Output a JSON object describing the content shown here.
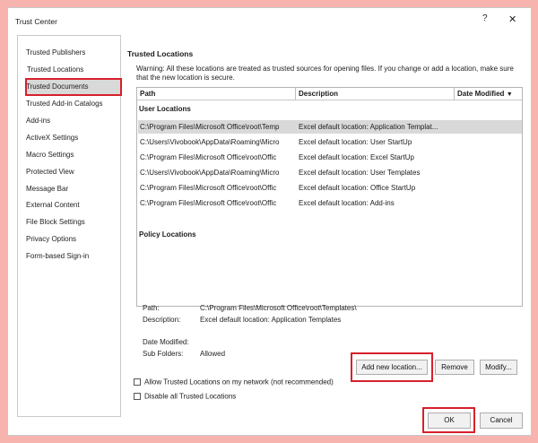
{
  "window": {
    "title": "Trust Center",
    "help_label": "?",
    "close_label": "✕"
  },
  "sidebar": {
    "items": [
      {
        "label": "Trusted Publishers"
      },
      {
        "label": "Trusted Locations"
      },
      {
        "label": "Trusted Documents"
      },
      {
        "label": "Trusted Add-in Catalogs"
      },
      {
        "label": "Add-ins"
      },
      {
        "label": "ActiveX Settings"
      },
      {
        "label": "Macro Settings"
      },
      {
        "label": "Protected View"
      },
      {
        "label": "Message Bar"
      },
      {
        "label": "External Content"
      },
      {
        "label": "File Block Settings"
      },
      {
        "label": "Privacy Options"
      },
      {
        "label": "Form-based Sign-in"
      }
    ],
    "selected": "Trusted Locations"
  },
  "main": {
    "heading": "Trusted Locations",
    "warning": "Warning: All these locations are treated as trusted sources for opening files.  If you change or add a location, make sure that the new location is secure.",
    "columns": {
      "path": "Path",
      "description": "Description",
      "date_modified": "Date Modified",
      "sort_icon": "▼"
    },
    "user_locations_label": "User Locations",
    "policy_locations_label": "Policy Locations",
    "rows": [
      {
        "path": "C:\\Program Files\\Microsoft Office\\root\\Temp",
        "description": "Excel default location: Application Templat..."
      },
      {
        "path": "C:\\Users\\Vivobook\\AppData\\Roaming\\Micro",
        "description": "Excel default location: User StartUp"
      },
      {
        "path": "C:\\Program Files\\Microsoft Office\\root\\Offic",
        "description": "Excel default location: Excel StartUp"
      },
      {
        "path": "C:\\Users\\Vivobook\\AppData\\Roaming\\Micro",
        "description": "Excel default location: User Templates"
      },
      {
        "path": "C:\\Program Files\\Microsoft Office\\root\\Offic",
        "description": "Excel default location: Office StartUp"
      },
      {
        "path": "C:\\Program Files\\Microsoft Office\\root\\Offic",
        "description": "Excel default location: Add-ins"
      }
    ],
    "details": {
      "path_label": "Path:",
      "path_value": "C:\\Program Files\\Microsoft Office\\root\\Templates\\",
      "description_label": "Description:",
      "description_value": "Excel default location: Application Templates",
      "date_label": "Date Modified:",
      "subfolders_label": "Sub Folders:",
      "subfolders_value": "Allowed"
    },
    "buttons": {
      "add": "Add new location...",
      "remove": "Remove",
      "modify": "Modify..."
    },
    "checkboxes": {
      "allow_network": "Allow Trusted Locations on my network (not recommended)",
      "disable_all": "Disable all Trusted Locations"
    }
  },
  "footer": {
    "ok": "OK",
    "cancel": "Cancel"
  },
  "colors": {
    "highlight": "#d7202b",
    "background": "#f7b3ad",
    "selected_row": "#d9d9d9"
  }
}
